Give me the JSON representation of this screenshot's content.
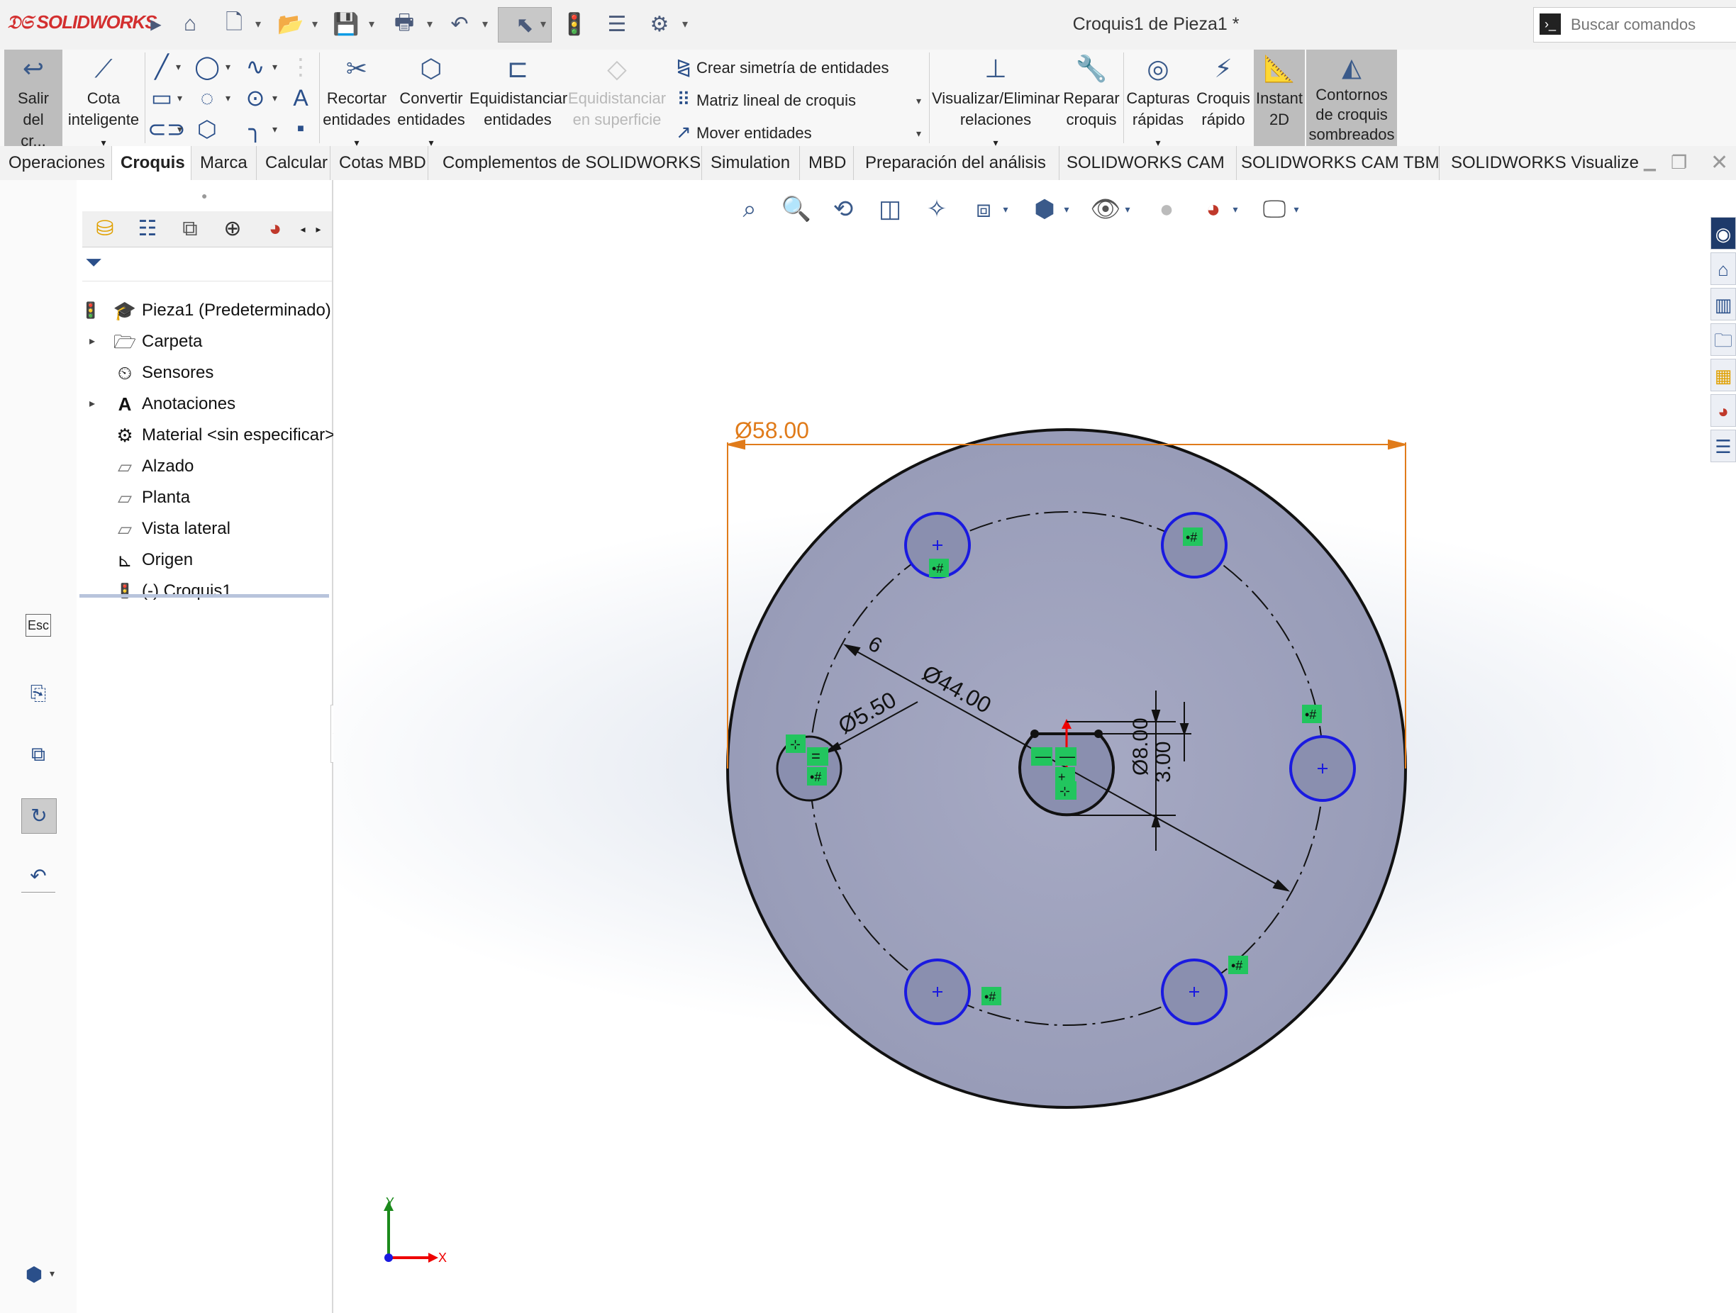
{
  "app": {
    "logo": "SOLIDWORKS",
    "window_title": "Croquis1 de Pieza1 *",
    "search_placeholder": "Buscar comandos"
  },
  "ribbon": {
    "exit_sketch": "Salir del cr...",
    "smart_dim": [
      "Cota",
      "inteligente"
    ],
    "trim": [
      "Recortar",
      "entidades"
    ],
    "convert": [
      "Convertir",
      "entidades"
    ],
    "offset": [
      "Equidistanciar",
      "entidades"
    ],
    "offset_surface": [
      "Equidistanciar",
      "en superficie"
    ],
    "mirror": "Crear simetría de entidades",
    "linear_pattern": "Matriz lineal de croquis",
    "move": "Mover entidades",
    "relations": [
      "Visualizar/Eliminar",
      "relaciones"
    ],
    "repair": [
      "Reparar",
      "croquis"
    ],
    "quick_snaps": [
      "Capturas",
      "rápidas"
    ],
    "rapid_sketch": [
      "Croquis",
      "rápido"
    ],
    "instant2d": [
      "Instant",
      "2D"
    ],
    "shaded_contours": [
      "Contornos",
      "de croquis",
      "sombreados"
    ]
  },
  "tabs": [
    "Operaciones",
    "Croquis",
    "Marca",
    "Calcular",
    "Cotas MBD",
    "Complementos de SOLIDWORKS",
    "Simulation",
    "MBD",
    "Preparación del análisis",
    "SOLIDWORKS CAM",
    "SOLIDWORKS CAM TBM",
    "SOLIDWORKS Visualize"
  ],
  "tree": {
    "root": "Pieza1  (Predeterminado)",
    "items": [
      "Carpeta",
      "Sensores",
      "Anotaciones",
      "Material <sin especificar>",
      "Alzado",
      "Planta",
      "Vista lateral",
      "Origen",
      "(-) Croquis1"
    ]
  },
  "left_strip": {
    "esc": "Esc"
  },
  "sketch": {
    "dim_outer": "Ø58.00",
    "dim_bolt_circle": "Ø44.00",
    "dim_hole": "Ø5.50",
    "dim_center_hole": "Ø8.00",
    "dim_flat": "3.00",
    "dim_count": "6"
  },
  "triad": {
    "x": "X",
    "y": "Y"
  },
  "colors": {
    "accent": "#d32f2f",
    "dimension": "#e07b1a",
    "sketch_blue": "#1a1ae0",
    "disc_fill": "#9a9fbb",
    "relation_green": "#22c55e"
  }
}
